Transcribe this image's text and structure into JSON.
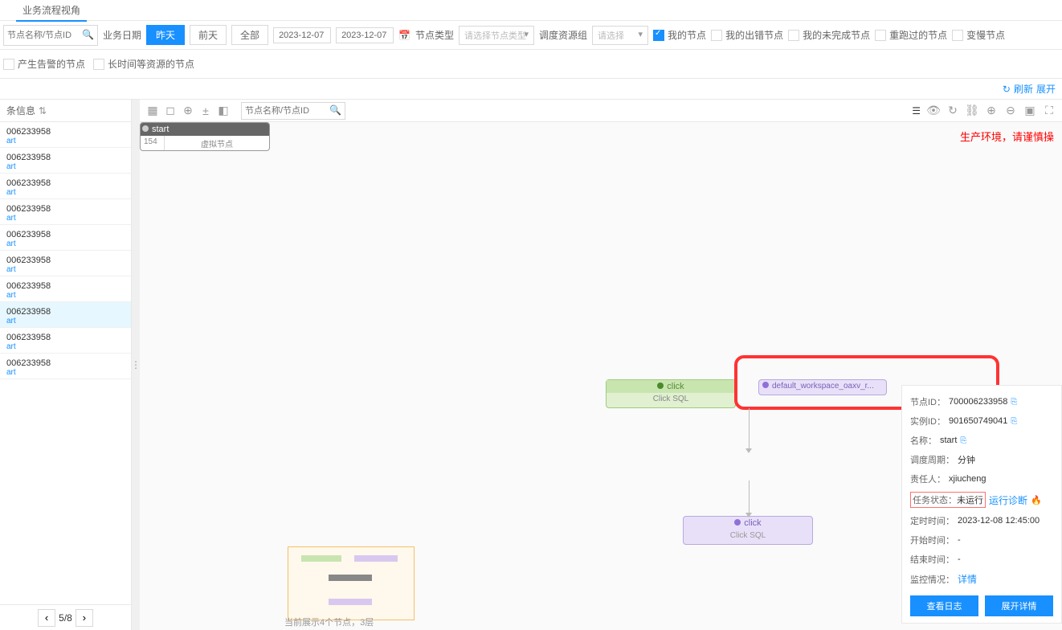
{
  "header": {
    "tab": "业务流程视角"
  },
  "toolbar": {
    "search_placeholder": "节点名称/节点ID",
    "biz_date_label": "业务日期",
    "btn_today": "昨天",
    "btn_yesterday": "前天",
    "btn_all": "全部",
    "date_from": "2023-12-07",
    "date_to": "2023-12-07",
    "node_type_label": "节点类型",
    "node_type_placeholder": "请选择节点类型",
    "resource_label": "调度资源组",
    "resource_placeholder": "请选择",
    "cb_my_nodes": "我的节点",
    "cb_error_nodes": "我的出错节点",
    "cb_undone_nodes": "我的未完成节点",
    "cb_rerun_nodes": "重跑过的节点",
    "cb_slow_nodes": "变慢节点",
    "cb_alarm_nodes": "产生告警的节点",
    "cb_wait_nodes": "长时间等资源的节点"
  },
  "refresh": {
    "label": "刷新",
    "expand": "展开"
  },
  "left": {
    "header": "条信息",
    "pager": "5/8",
    "items": [
      {
        "id": "006233958",
        "sub": "art"
      },
      {
        "id": "006233958",
        "sub": "art"
      },
      {
        "id": "006233958",
        "sub": "art"
      },
      {
        "id": "006233958",
        "sub": "art"
      },
      {
        "id": "006233958",
        "sub": "art"
      },
      {
        "id": "006233958",
        "sub": "art"
      },
      {
        "id": "006233958",
        "sub": "art"
      },
      {
        "id": "006233958",
        "sub": "art"
      },
      {
        "id": "006233958",
        "sub": "art"
      },
      {
        "id": "006233958",
        "sub": "art"
      }
    ]
  },
  "canvas": {
    "search_placeholder": "节点名称/节点ID",
    "warning": "生产环境，请谨慎操",
    "node_click": "click",
    "node_click_sub": "Click SQL",
    "node_default": "default_workspace_oaxv_r...",
    "node_start": "start",
    "node_start_id": "154",
    "node_start_sub": "虚拟节点",
    "node_click2": "click",
    "node_click2_sub": "Click SQL",
    "footer": "当前展示4个节点，3层"
  },
  "detail": {
    "node_id_k": "节点ID：",
    "node_id_v": "700006233958",
    "inst_id_k": "实例ID：",
    "inst_id_v": "901650749041",
    "name_k": "名称：",
    "name_v": "start",
    "period_k": "调度周期：",
    "period_v": "分钟",
    "owner_k": "责任人：",
    "owner_v": "xjiucheng",
    "status_k": "任务状态：",
    "status_v": "未运行",
    "diag_link": "运行诊断",
    "sched_k": "定时时间：",
    "sched_v": "2023-12-08 12:45:00",
    "start_k": "开始时间：",
    "start_v": "-",
    "end_k": "结束时间：",
    "end_v": "-",
    "monitor_k": "监控情况：",
    "monitor_v": "详情",
    "btn_log": "查看日志",
    "btn_expand": "展开详情"
  }
}
